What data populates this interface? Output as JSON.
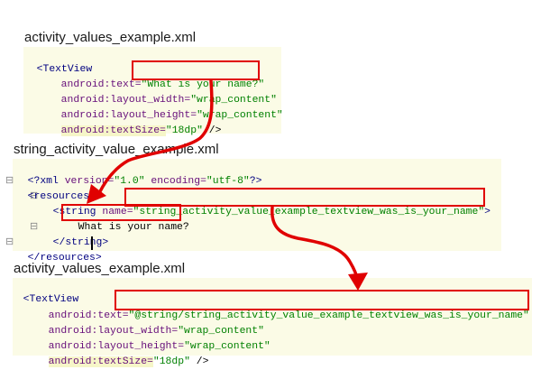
{
  "sections": {
    "first": {
      "title": "activity_values_example.xml",
      "open_tag": "<TextView",
      "text_attr": "android:text=",
      "text_value": "\"What is your name?\"",
      "width_attr": "android:layout_width=",
      "width_value": "\"wrap_content\"",
      "height_attr": "android:layout_height=",
      "height_value": "\"wrap_content\"",
      "size_attr": "android:textSize=",
      "size_value": "\"18dp\"",
      "close": " />"
    },
    "second": {
      "title": "string_activity_value_example.xml",
      "xml_decl_start": "<?xml ",
      "version_attr": "version=",
      "version_value": "\"1.0\"",
      "encoding_attr": " encoding=",
      "encoding_value": "\"utf-8\"",
      "xml_decl_end": "?>",
      "resources_open": "<resources>",
      "string_open": "<string ",
      "name_attr": "name=",
      "name_value": "\"string_activity_value_example_textview_was_is_your_name\"",
      "string_open_end": ">",
      "content": "What is your name?",
      "string_close": "</string>",
      "resources_close": "</resources>"
    },
    "third": {
      "title": "activity_values_example.xml",
      "open_tag": "<TextView",
      "text_attr": "android:text=",
      "text_value": "\"@string/string_activity_value_example_textview_was_is_your_name\"",
      "width_attr": "android:layout_width=",
      "width_value": "\"wrap_content\"",
      "height_attr": "android:layout_height=",
      "height_value": "\"wrap_content\"",
      "size_attr": "android:textSize=",
      "size_value": "\"18dp\"",
      "close": " />"
    }
  },
  "colors": {
    "highlight_box": "#e00000",
    "tag": "#000080",
    "attribute": "#660e7a",
    "string": "#008000",
    "line_highlight": "#fbfbe6"
  }
}
